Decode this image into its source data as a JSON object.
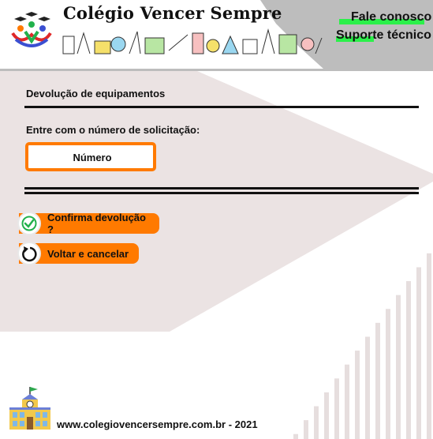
{
  "header": {
    "title": "Colégio Vencer Sempre",
    "links": [
      {
        "label": "Fale conosco"
      },
      {
        "label": "Suporte técnico"
      }
    ]
  },
  "main": {
    "section_title": "Devolução de equipamentos",
    "prompt": "Entre com o número de solicitação:",
    "number_input": {
      "placeholder": "Número",
      "value": ""
    },
    "actions": [
      {
        "label": "Confirma devolução ?",
        "icon": "check-circle-icon"
      },
      {
        "label": "Voltar e cancelar",
        "icon": "undo-arrow-icon"
      }
    ]
  },
  "footer": {
    "text": "www.colegiovencersempre.com.br - 2021"
  },
  "colors": {
    "accent": "#ff7a00",
    "highlight": "#2bf04a",
    "header_bg": "#bcbcbc",
    "panel_bg": "#ebe3e3",
    "check": "#22b14c"
  }
}
